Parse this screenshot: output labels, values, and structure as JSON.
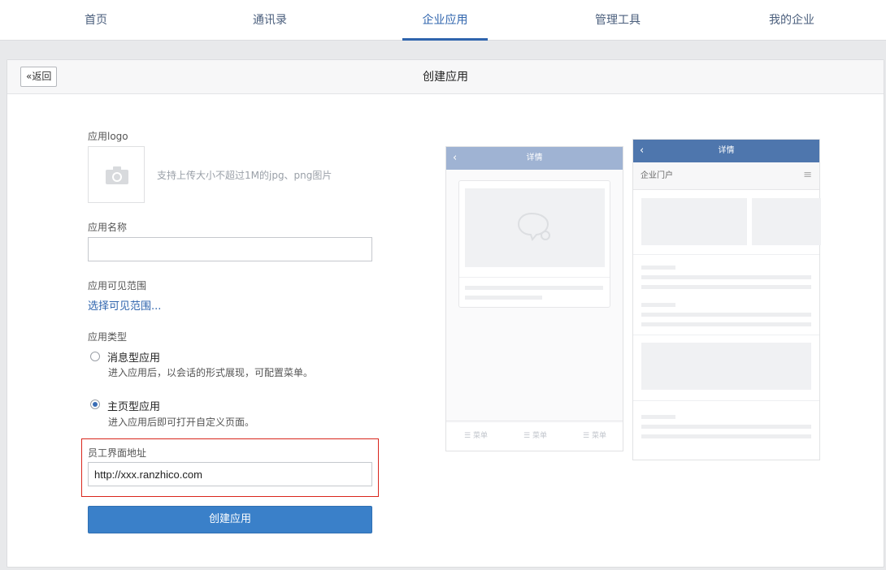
{
  "nav": {
    "tabs": [
      {
        "label": "首页"
      },
      {
        "label": "通讯录"
      },
      {
        "label": "企业应用"
      },
      {
        "label": "管理工具"
      },
      {
        "label": "我的企业"
      }
    ],
    "active_index": 2
  },
  "header": {
    "back_label": "返回",
    "title": "创建应用"
  },
  "form": {
    "logo_label": "应用logo",
    "logo_hint": "支持上传大小不超过1M的jpg、png图片",
    "name_label": "应用名称",
    "name_value": "",
    "scope_label": "应用可见范围",
    "scope_link": "选择可见范围...",
    "type_label": "应用类型",
    "types": [
      {
        "title": "消息型应用",
        "desc": "进入应用后，以会话的形式展现，可配置菜单。",
        "checked": false
      },
      {
        "title": "主页型应用",
        "desc": "进入应用后即可打开自定义页面。",
        "checked": true
      }
    ],
    "url_label": "员工界面地址",
    "url_value": "http://xxx.ranzhico.com",
    "submit_label": "创建应用"
  },
  "preview": {
    "phone1": {
      "title": "详情",
      "menu": [
        "菜单",
        "菜单",
        "菜单"
      ]
    },
    "phone2": {
      "title": "详情",
      "subtitle": "企业门户"
    }
  },
  "colors": {
    "accent": "#2f64ad",
    "button": "#3a80c9",
    "highlight_border": "#d9261c",
    "phone1_bar": "#9fb3d3",
    "phone2_bar": "#4e76ad"
  },
  "icons": [
    "camera-icon",
    "chevron-left-icon",
    "chat-bubble-icon",
    "hamburger-icon",
    "menu-list-icon"
  ]
}
